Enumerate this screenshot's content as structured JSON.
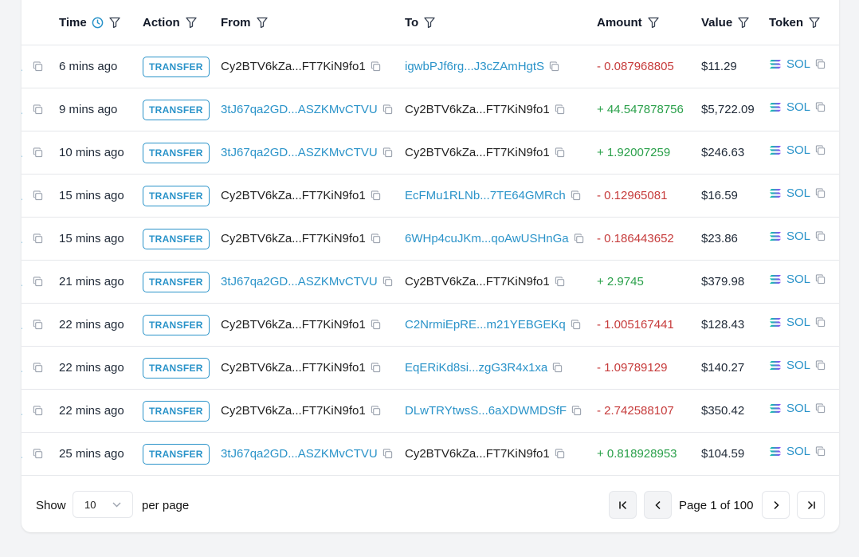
{
  "columns": {
    "time": "Time",
    "action": "Action",
    "from": "From",
    "to": "To",
    "amount": "Amount",
    "value": "Value",
    "token": "Token"
  },
  "rows": [
    {
      "time": "6 mins ago",
      "action": "TRANSFER",
      "from": "Cy2BTV6kZa...FT7KiN9fo1",
      "from_link": false,
      "to": "igwbPJf6rg...J3cZAmHgtS",
      "to_link": true,
      "amount": "- 0.087968805",
      "sign": "neg",
      "value": "$11.29",
      "token": "SOL"
    },
    {
      "time": "9 mins ago",
      "action": "TRANSFER",
      "from": "3tJ67qa2GD...ASZKMvCTVU",
      "from_link": true,
      "to": "Cy2BTV6kZa...FT7KiN9fo1",
      "to_link": false,
      "amount": "+ 44.547878756",
      "sign": "pos",
      "value": "$5,722.09",
      "token": "SOL"
    },
    {
      "time": "10 mins ago",
      "action": "TRANSFER",
      "from": "3tJ67qa2GD...ASZKMvCTVU",
      "from_link": true,
      "to": "Cy2BTV6kZa...FT7KiN9fo1",
      "to_link": false,
      "amount": "+ 1.92007259",
      "sign": "pos",
      "value": "$246.63",
      "token": "SOL"
    },
    {
      "time": "15 mins ago",
      "action": "TRANSFER",
      "from": "Cy2BTV6kZa...FT7KiN9fo1",
      "from_link": false,
      "to": "EcFMu1RLNb...7TE64GMRch",
      "to_link": true,
      "amount": "- 0.12965081",
      "sign": "neg",
      "value": "$16.59",
      "token": "SOL"
    },
    {
      "time": "15 mins ago",
      "action": "TRANSFER",
      "from": "Cy2BTV6kZa...FT7KiN9fo1",
      "from_link": false,
      "to": "6WHp4cuJKm...qoAwUSHnGa",
      "to_link": true,
      "amount": "- 0.186443652",
      "sign": "neg",
      "value": "$23.86",
      "token": "SOL"
    },
    {
      "time": "21 mins ago",
      "action": "TRANSFER",
      "from": "3tJ67qa2GD...ASZKMvCTVU",
      "from_link": true,
      "to": "Cy2BTV6kZa...FT7KiN9fo1",
      "to_link": false,
      "amount": "+ 2.9745",
      "sign": "pos",
      "value": "$379.98",
      "token": "SOL"
    },
    {
      "time": "22 mins ago",
      "action": "TRANSFER",
      "from": "Cy2BTV6kZa...FT7KiN9fo1",
      "from_link": false,
      "to": "C2NrmiEpRE...m21YEBGEKq",
      "to_link": true,
      "amount": "- 1.005167441",
      "sign": "neg",
      "value": "$128.43",
      "token": "SOL"
    },
    {
      "time": "22 mins ago",
      "action": "TRANSFER",
      "from": "Cy2BTV6kZa...FT7KiN9fo1",
      "from_link": false,
      "to": "EqERiKd8si...zgG3R4x1xa",
      "to_link": true,
      "amount": "- 1.09789129",
      "sign": "neg",
      "value": "$140.27",
      "token": "SOL"
    },
    {
      "time": "22 mins ago",
      "action": "TRANSFER",
      "from": "Cy2BTV6kZa...FT7KiN9fo1",
      "from_link": false,
      "to": "DLwTRYtwsS...6aXDWMDSfF",
      "to_link": true,
      "amount": "- 2.742588107",
      "sign": "neg",
      "value": "$350.42",
      "token": "SOL"
    },
    {
      "time": "25 mins ago",
      "action": "TRANSFER",
      "from": "3tJ67qa2GD...ASZKMvCTVU",
      "from_link": true,
      "to": "Cy2BTV6kZa...FT7KiN9fo1",
      "to_link": false,
      "amount": "+ 0.818928953",
      "sign": "pos",
      "value": "$104.59",
      "token": "SOL"
    }
  ],
  "footer": {
    "show_label": "Show",
    "page_size": "10",
    "per_page_label": "per page",
    "page_text": "Page 1 of 100"
  },
  "colors": {
    "link": "#2a93c9",
    "negative": "#c63b3b",
    "positive": "#2aa04a",
    "border": "#e5e7eb"
  },
  "icons": [
    "clock-icon",
    "filter-icon",
    "copy-icon",
    "solana-icon",
    "chevron-down-icon",
    "first-page-icon",
    "prev-page-icon",
    "next-page-icon",
    "last-page-icon"
  ]
}
